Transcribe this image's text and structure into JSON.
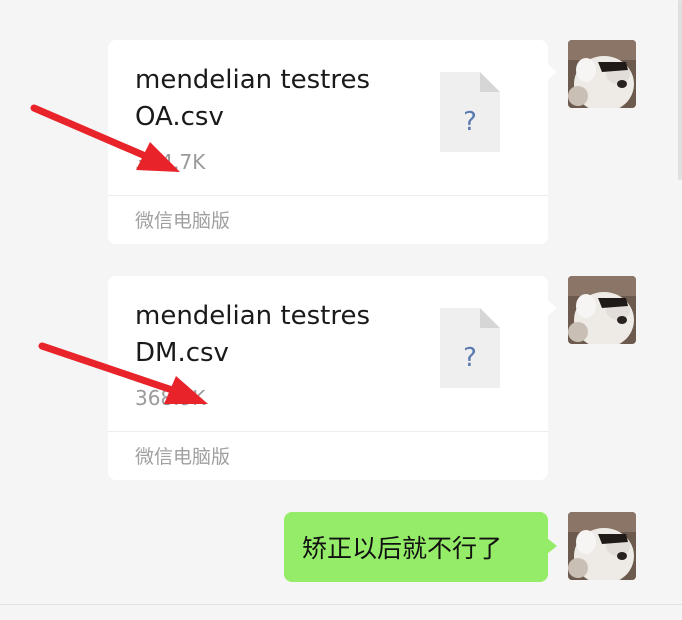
{
  "messages": [
    {
      "type": "file",
      "file_name": "mendelian testres OA.csv",
      "file_size": "394.7K",
      "source": "微信电脑版",
      "file_icon": "unknown-file-icon"
    },
    {
      "type": "file",
      "file_name": "mendelian testres DM.csv",
      "file_size": "368.9K",
      "source": "微信电脑版",
      "file_icon": "unknown-file-icon"
    },
    {
      "type": "text",
      "text": "矫正以后就不行了"
    }
  ],
  "colors": {
    "background": "#f5f5f5",
    "sent_bubble": "#95ec69",
    "file_card": "#ffffff",
    "annotation_arrow": "#e8232a"
  }
}
